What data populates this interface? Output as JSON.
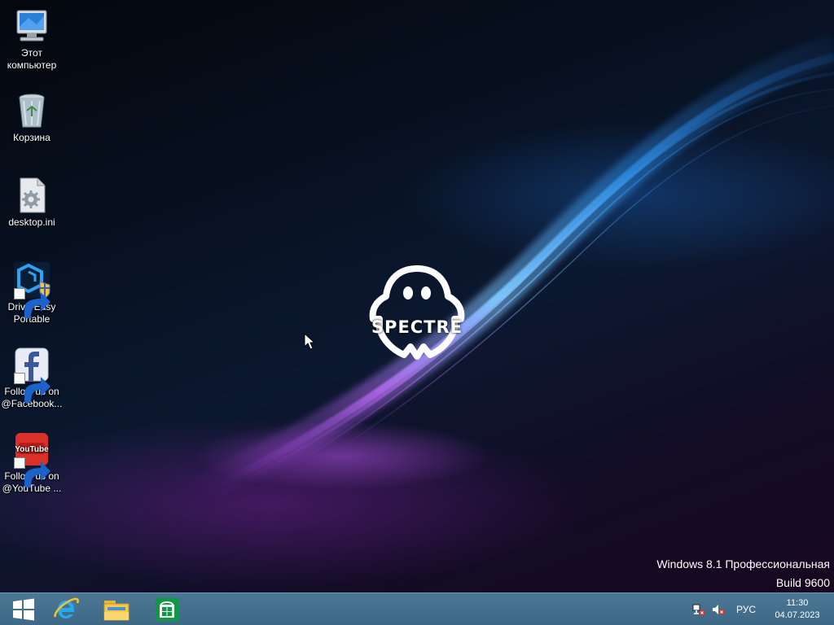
{
  "desktop_icons": [
    {
      "label": "Этот\nкомпьютер",
      "icon": "computer-icon",
      "shortcut": false
    },
    {
      "label": "Корзина",
      "icon": "recycle-bin-icon",
      "shortcut": false
    },
    {
      "label": "desktop.ini",
      "icon": "settings-file-icon",
      "shortcut": false
    },
    {
      "label": "DriverEasy\nPortable",
      "icon": "drivereasy-icon",
      "shortcut": true
    },
    {
      "label": "Follow us on\n@Facebook...",
      "icon": "facebook-icon",
      "shortcut": true
    },
    {
      "label": "Follow us on\n@YouTube ...",
      "icon": "youtube-icon",
      "shortcut": true
    }
  ],
  "wallpaper": {
    "logo_text": "SPECTRE"
  },
  "watermark": {
    "line1": "Windows 8.1 Профессиональная",
    "line2": "Build 9600"
  },
  "taskbar": {
    "pinned": [
      "start-icon",
      "internet-explorer-icon",
      "file-explorer-icon",
      "store-icon"
    ],
    "tray": {
      "language": "РУС",
      "time": "11:30",
      "date": "04.07.2023"
    }
  },
  "colors": {
    "taskbar": "#4c7896",
    "accent_blue": "#3fa9ff",
    "accent_purple": "#b55cff"
  }
}
